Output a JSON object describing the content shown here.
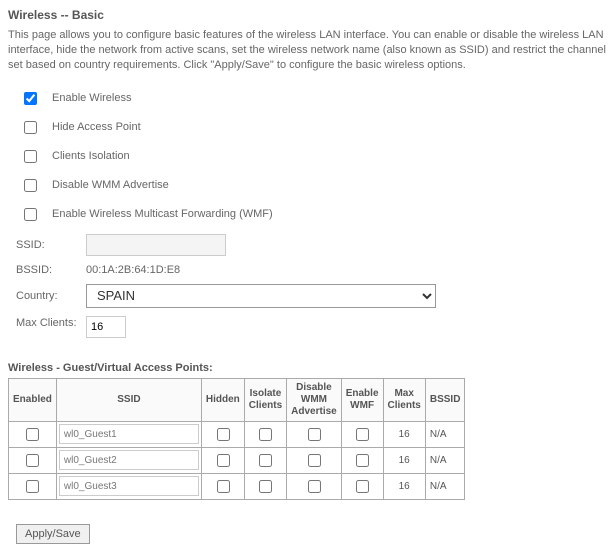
{
  "title": "Wireless -- Basic",
  "intro": "This page allows you to configure basic features of the wireless LAN interface. You can enable or disable the wireless LAN interface, hide the network from active scans, set the wireless network name (also known as SSID) and restrict the channel set based on country requirements. Click \"Apply/Save\" to configure the basic wireless options.",
  "checkboxes": {
    "enable_wireless": {
      "label": "Enable Wireless",
      "checked": true
    },
    "hide_ap": {
      "label": "Hide Access Point",
      "checked": false
    },
    "clients_iso": {
      "label": "Clients Isolation",
      "checked": false
    },
    "disable_wmm": {
      "label": "Disable WMM Advertise",
      "checked": false
    },
    "enable_wmf": {
      "label": "Enable Wireless Multicast Forwarding (WMF)",
      "checked": false
    }
  },
  "fields": {
    "ssid_label": "SSID:",
    "ssid_value": "",
    "bssid_label": "BSSID:",
    "bssid_value": "00:1A:2B:64:1D:E8",
    "country_label": "Country:",
    "country_value": "SPAIN",
    "max_clients_label": "Max Clients:",
    "max_clients_value": "16"
  },
  "guest_section_title": "Wireless - Guest/Virtual Access Points:",
  "guest_headers": {
    "enabled": "Enabled",
    "ssid": "SSID",
    "hidden": "Hidden",
    "isolate": "Isolate Clients",
    "disable_wmm": "Disable WMM Advertise",
    "enable_wmf": "Enable WMF",
    "max_clients": "Max Clients",
    "bssid": "BSSID"
  },
  "guest_rows": [
    {
      "enabled": false,
      "ssid": "wl0_Guest1",
      "hidden": false,
      "isolate": false,
      "disable_wmm": false,
      "enable_wmf": false,
      "max_clients": "16",
      "bssid": "N/A"
    },
    {
      "enabled": false,
      "ssid": "wl0_Guest2",
      "hidden": false,
      "isolate": false,
      "disable_wmm": false,
      "enable_wmf": false,
      "max_clients": "16",
      "bssid": "N/A"
    },
    {
      "enabled": false,
      "ssid": "wl0_Guest3",
      "hidden": false,
      "isolate": false,
      "disable_wmm": false,
      "enable_wmf": false,
      "max_clients": "16",
      "bssid": "N/A"
    }
  ],
  "apply_button": "Apply/Save"
}
